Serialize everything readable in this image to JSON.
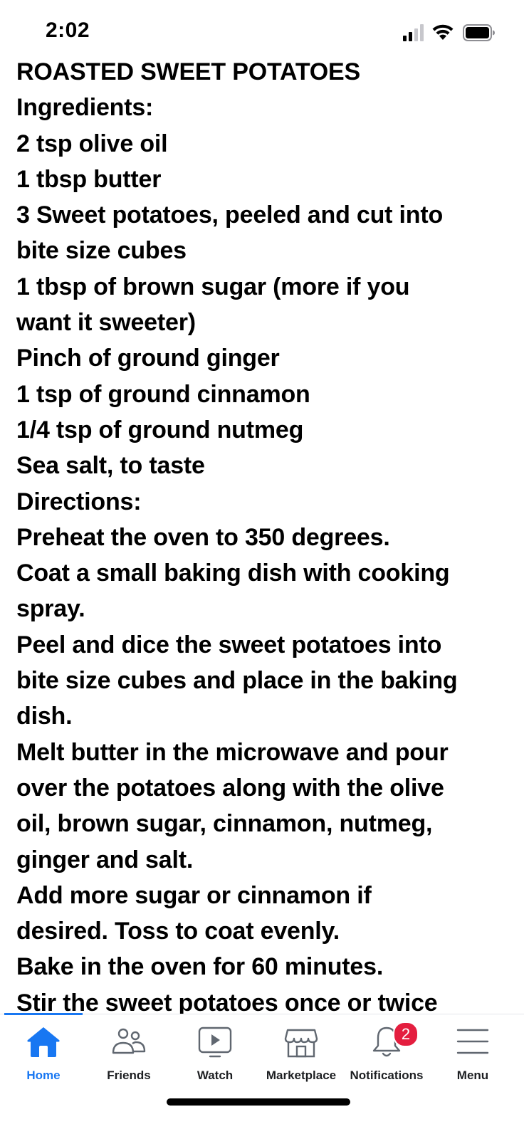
{
  "status_bar": {
    "time": "2:02"
  },
  "recipe": {
    "lines": [
      "ROASTED SWEET POTATOES",
      "Ingredients:",
      "2 tsp olive oil",
      "1 tbsp butter",
      "3 Sweet potatoes, peeled and cut into",
      "bite size cubes",
      "1 tbsp of brown sugar (more if you",
      "want it sweeter)",
      "Pinch of ground ginger",
      "1 tsp of ground cinnamon",
      "1/4 tsp of ground nutmeg",
      "Sea salt, to taste",
      "Directions:",
      "Preheat the oven to 350 degrees.",
      "Coat a small baking dish with cooking",
      "spray.",
      "Peel and dice the sweet potatoes into",
      "bite size cubes and place in the baking",
      "dish.",
      "Melt butter in the microwave and pour",
      "over the potatoes along with the olive",
      "oil, brown sugar, cinnamon, nutmeg,",
      "ginger and salt.",
      "Add more sugar or cinnamon if",
      "desired. Toss to coat evenly.",
      "Bake in the oven for 60 minutes.",
      "Stir the sweet potatoes once or twice"
    ]
  },
  "tab_bar": {
    "accent_color": "#1877f2",
    "tabs": [
      {
        "label": "Home",
        "icon": "home-icon",
        "active": true
      },
      {
        "label": "Friends",
        "icon": "friends-icon"
      },
      {
        "label": "Watch",
        "icon": "watch-icon"
      },
      {
        "label": "Marketplace",
        "icon": "marketplace-icon"
      },
      {
        "label": "Notifications",
        "icon": "bell-icon",
        "badge": "2"
      },
      {
        "label": "Menu",
        "icon": "menu-icon"
      }
    ]
  }
}
